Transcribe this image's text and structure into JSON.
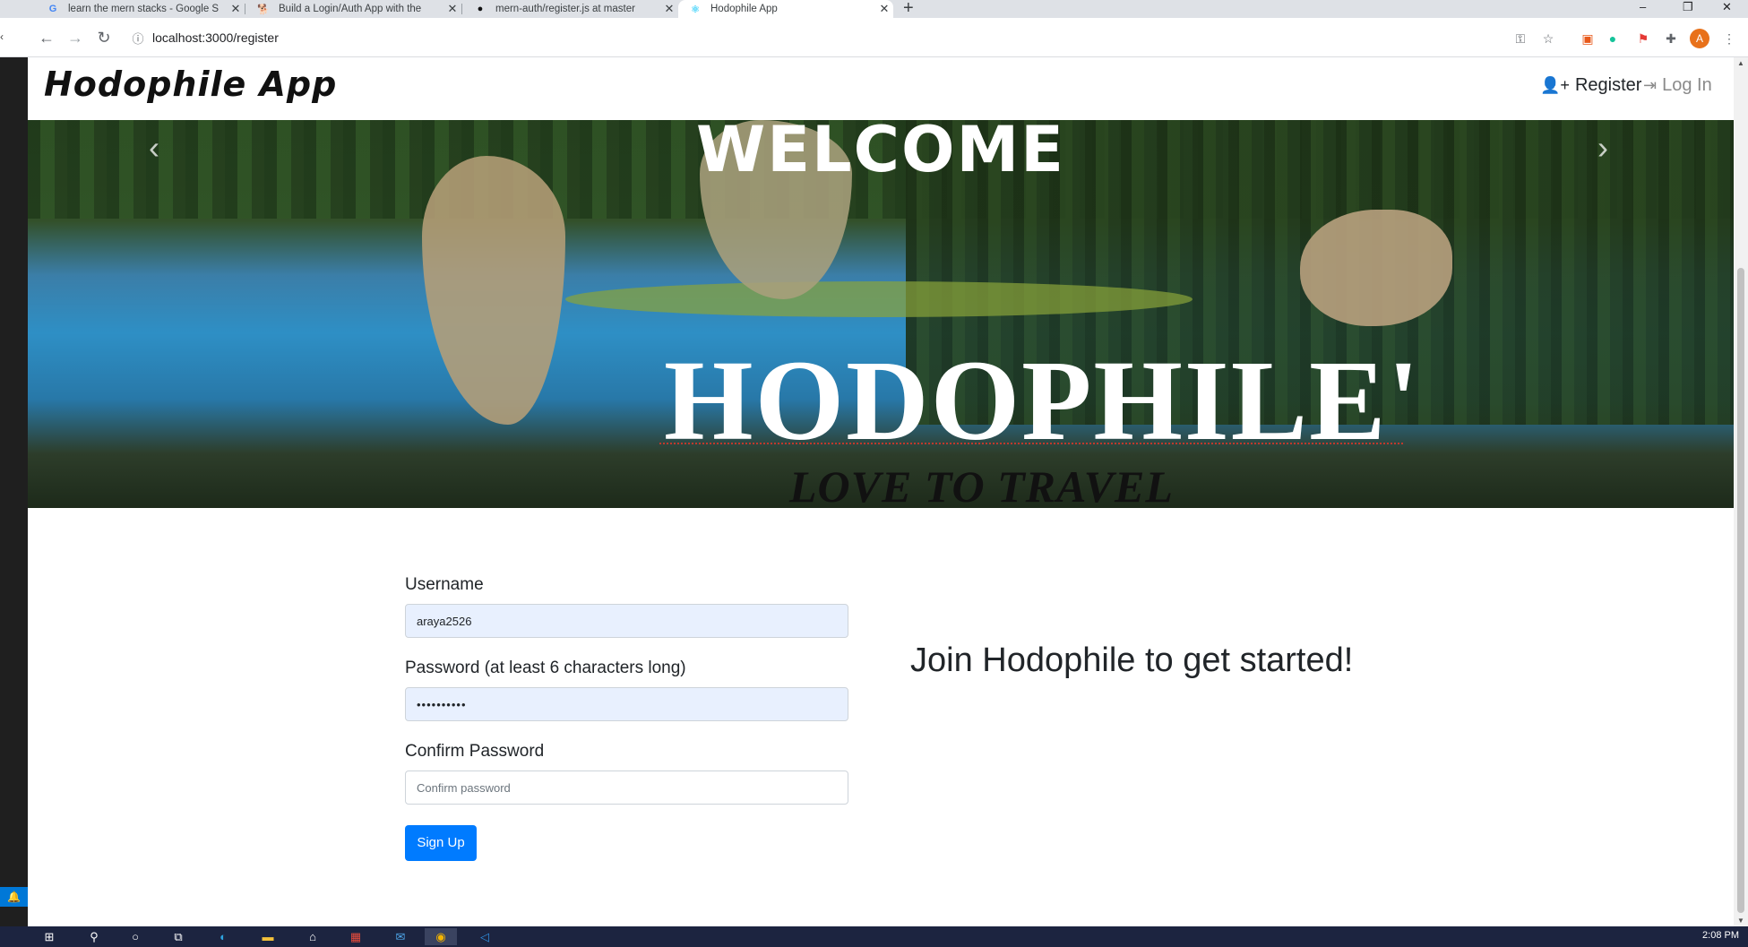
{
  "browser": {
    "tabs": [
      {
        "title": "learn the mern stacks - Google S",
        "icon": "google-icon"
      },
      {
        "title": "Build a Login/Auth App with the",
        "icon": "dog-icon"
      },
      {
        "title": "mern-auth/register.js at master",
        "icon": "github-icon"
      },
      {
        "title": "Hodophile App",
        "icon": "react-icon",
        "active": true
      }
    ],
    "url": "localhost:3000/register",
    "profile_initial": "A"
  },
  "navbar": {
    "brand": "Hodophile App",
    "register_label": "Register",
    "login_label": "Log In"
  },
  "hero": {
    "welcome": "WELCOME",
    "logo_text": "HODOPHILE'",
    "tagline": "LOVE TO TRAVEL"
  },
  "form": {
    "username_label": "Username",
    "username_value": "araya2526",
    "password_label": "Password (at least 6 characters long)",
    "password_value": "••••••••••",
    "confirm_label": "Confirm Password",
    "confirm_placeholder": "Confirm password",
    "submit_label": "Sign Up"
  },
  "side_heading": "Join Hodophile to get started!",
  "taskbar": {
    "clock": "2:08 PM"
  }
}
